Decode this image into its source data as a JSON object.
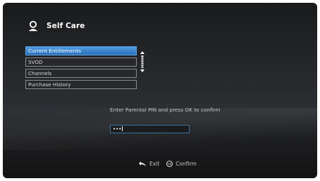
{
  "header": {
    "title": "Self Care",
    "icon": "user-icon"
  },
  "menu": {
    "items": [
      {
        "label": "Current Entitlements",
        "selected": true
      },
      {
        "label": "SVOD",
        "selected": false
      },
      {
        "label": "Channels",
        "selected": false
      },
      {
        "label": "Purchase History",
        "selected": false
      }
    ]
  },
  "pin_dialog": {
    "prompt": "Enter Parental PIN and press OK to confirm",
    "value": "•••"
  },
  "footer": {
    "exit_label": "Exit",
    "confirm_label": "Confirm",
    "exit_icon": "back-arrow-icon",
    "confirm_icon": "ok-button-icon"
  },
  "colors": {
    "accent": "#3a86d4",
    "background": "#232528"
  }
}
